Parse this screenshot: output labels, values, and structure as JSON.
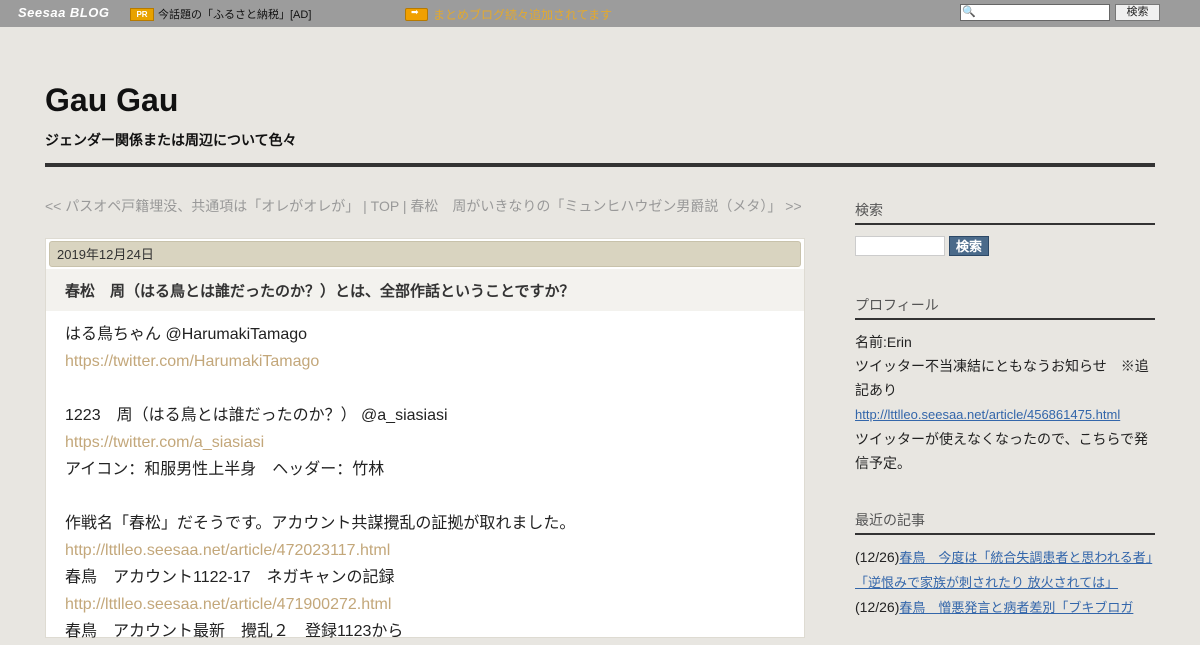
{
  "topbar": {
    "logo": "Seesaa BLOG",
    "pr_badge": "PR",
    "pr_text": "今話題の「ふるさと納税」[AD]",
    "notice": "まとめブログ続々追加されてます",
    "search_button": "検索"
  },
  "header": {
    "title": "Gau Gau",
    "description": "ジェンダー関係または周辺について色々"
  },
  "nav": {
    "prev": "<< パスオペ戸籍埋没、共通項は「オレがオレが」",
    "sep1": " | ",
    "top": "TOP",
    "sep2": " | ",
    "next": "春松　周がいきなりの「ミュンヒハウゼン男爵説（メタ）」 >>"
  },
  "article": {
    "date": "2019年12月24日",
    "title": "春松　周（はる鳥とは誰だったのか？）とは、全部作話ということですか？",
    "lines": [
      {
        "text": "はる鳥ちゃん  @HarumakiTamago",
        "link": false
      },
      {
        "text": "https://twitter.com/HarumakiTamago",
        "link": true
      },
      {
        "text": "",
        "link": false
      },
      {
        "text": "1223　周（はる鳥とは誰だったのか？） @a_siasiasi",
        "link": false
      },
      {
        "text": "https://twitter.com/a_siasiasi",
        "link": true
      },
      {
        "text": "アイコン：和服男性上半身　ヘッダー：竹林",
        "link": false
      },
      {
        "text": "",
        "link": false
      },
      {
        "text": "作戦名「春松」だそうです。アカウント共謀攪乱の証拠が取れました。",
        "link": false
      },
      {
        "text": "http://lttlleo.seesaa.net/article/472023117.html",
        "link": true
      },
      {
        "text": "春鳥　アカウント1122-17　ネガキャンの記録",
        "link": false
      },
      {
        "text": "http://lttlleo.seesaa.net/article/471900272.html",
        "link": true
      },
      {
        "text": "春鳥　アカウント最新　攪乱２　登録1123から",
        "link": false
      }
    ]
  },
  "sidebar": {
    "search_heading": "検索",
    "search_button": "検索",
    "profile_heading": "プロフィール",
    "profile_name": "名前:Erin",
    "profile_text1": "ツイッター不当凍結にともなうお知らせ　※追記あり",
    "profile_link": "http://lttlleo.seesaa.net/article/456861475.html",
    "profile_text2": "ツイッターが使えなくなったので、こちらで発信予定。",
    "recent_heading": "最近の記事",
    "recent": [
      {
        "date": "(12/26)",
        "title": "春鳥　今度は「統合失調患者と思われる者」「逆恨みで家族が刺されたり 放火されては」"
      },
      {
        "date": "(12/26)",
        "title": "春鳥　憎悪発言と病者差別「ブキブロガ"
      }
    ]
  }
}
